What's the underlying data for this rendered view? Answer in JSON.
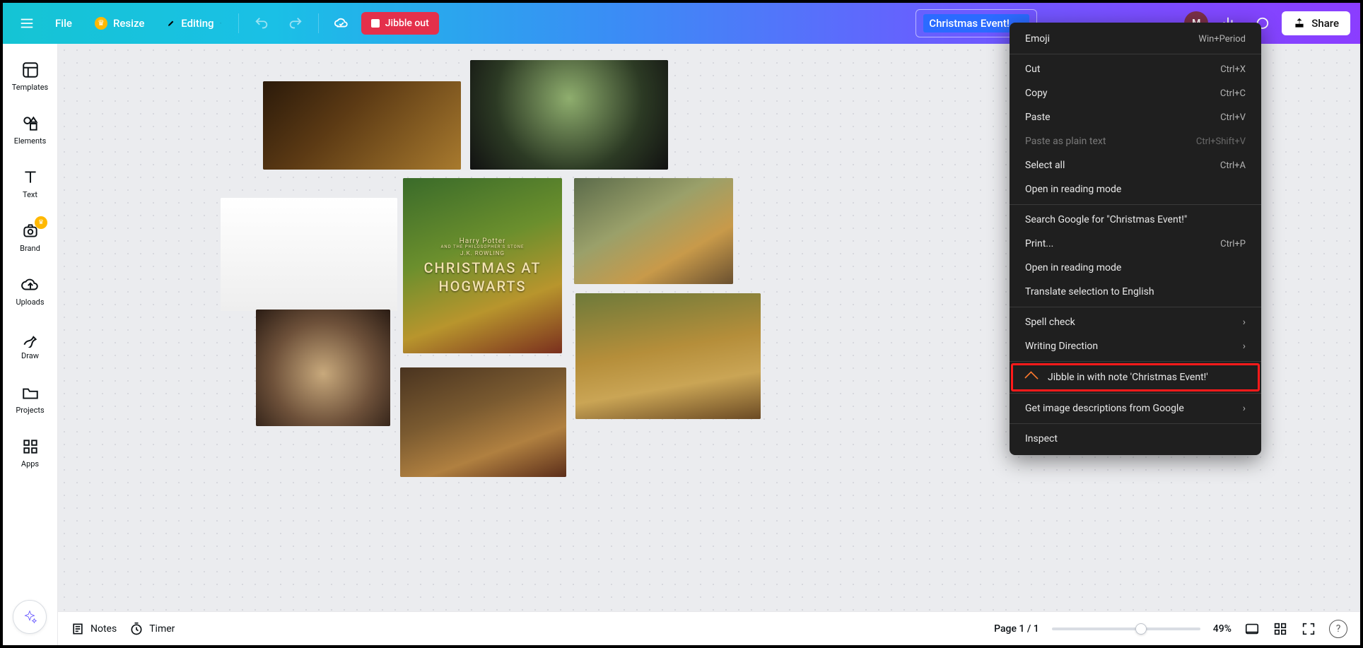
{
  "topbar": {
    "file": "File",
    "resize": "Resize",
    "editing": "Editing",
    "jibble_out": "Jibble out",
    "doc_title": "Christmas Event!",
    "share": "Share",
    "avatar_initial": "M"
  },
  "rail": {
    "items": [
      {
        "label": "Templates",
        "icon": "templates"
      },
      {
        "label": "Elements",
        "icon": "elements"
      },
      {
        "label": "Text",
        "icon": "text"
      },
      {
        "label": "Brand",
        "icon": "brand"
      },
      {
        "label": "Uploads",
        "icon": "uploads"
      },
      {
        "label": "Draw",
        "icon": "draw"
      },
      {
        "label": "Projects",
        "icon": "projects"
      },
      {
        "label": "Apps",
        "icon": "apps"
      }
    ]
  },
  "canvas": {
    "poster": {
      "line1": "Harry Potter",
      "line2": "AND THE PHILOSOPHER'S STONE",
      "line3": "J.K. ROWLING",
      "line4": "CHRISTMAS AT",
      "line5": "HOGWARTS"
    }
  },
  "context_menu": {
    "emoji": "Emoji",
    "emoji_k": "Win+Period",
    "cut": "Cut",
    "cut_k": "Ctrl+X",
    "copy": "Copy",
    "copy_k": "Ctrl+C",
    "paste": "Paste",
    "paste_k": "Ctrl+V",
    "paste_plain": "Paste as plain text",
    "paste_plain_k": "Ctrl+Shift+V",
    "select_all": "Select all",
    "select_all_k": "Ctrl+A",
    "reading1": "Open in reading mode",
    "search_google": "Search Google for \"Christmas Event!\"",
    "print": "Print...",
    "print_k": "Ctrl+P",
    "reading2": "Open in reading mode",
    "translate": "Translate selection to English",
    "spell": "Spell check",
    "writing_dir": "Writing Direction",
    "jibble_note": "Jibble in with note 'Christmas Event!'",
    "img_desc": "Get image descriptions from Google",
    "inspect": "Inspect"
  },
  "bottombar": {
    "notes": "Notes",
    "timer": "Timer",
    "page_indicator": "Page 1 / 1",
    "zoom": "49%"
  }
}
